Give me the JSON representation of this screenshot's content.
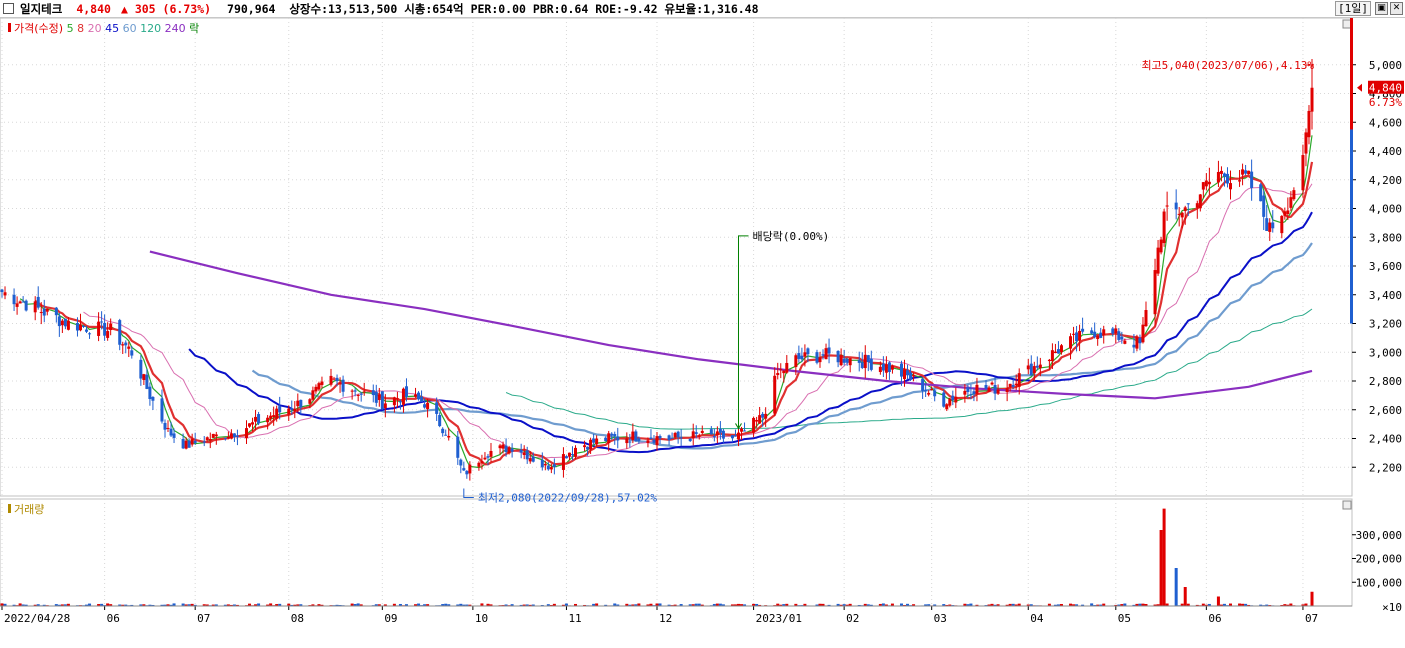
{
  "header": {
    "name": "일지테크",
    "price": "4,840",
    "change_arrow": "▲",
    "change": "305",
    "change_pct": "(6.73%)",
    "volume": "790,964",
    "listed_shares": "상장수:13,513,500",
    "market_cap": "시총:654억",
    "per": "PER:0.00",
    "pbr": "PBR:0.64",
    "roe": "ROE:-9.42",
    "reserve": "유보율:1,316.48",
    "period_label": "[1일]",
    "restore_icon": "restore-icon",
    "close_icon": "close-icon"
  },
  "legend": {
    "price_label": "가격(수정)",
    "ma_periods": [
      "5",
      "8",
      "20",
      "45",
      "60",
      "120",
      "240"
    ],
    "ma_colors": [
      "#2aa82a",
      "#e03030",
      "#d96fb0",
      "#0a10c8",
      "#6f9ccf",
      "#2aaa8a",
      "#8a2fc0"
    ],
    "ex_label": "락",
    "volume_label": "거래량"
  },
  "colors": {
    "up": "#e00000",
    "down": "#1f5fd0",
    "ma5": "#2aa82a",
    "ma8": "#e03030",
    "ma20": "#d96fb0",
    "ma45": "#0a10c8",
    "ma60": "#6f9ccf",
    "ma120": "#2aaa8a",
    "ma240": "#8a2fc0",
    "dividend": "#008000"
  },
  "annotations": {
    "high": "최고5,040(2023/07/06),4.13%",
    "low": "최저2,080(2022/09/28),57.02%",
    "dividend": "배당락(0.00%)",
    "current_price": "4,840",
    "current_pct": "6.73%"
  },
  "chart_data": {
    "type": "candlestick",
    "x_ticks": [
      "2022/04/28",
      "06",
      "07",
      "08",
      "09",
      "10",
      "11",
      "12",
      "2023/01",
      "02",
      "03",
      "04",
      "05",
      "06",
      "07"
    ],
    "y_ticks": [
      "2,200",
      "2,400",
      "2,600",
      "2,800",
      "3,000",
      "3,200",
      "3,400",
      "3,600",
      "3,800",
      "4,000",
      "4,200",
      "4,400",
      "4,600",
      "4,800",
      "5,000"
    ],
    "ylim": [
      2000,
      5200
    ],
    "close_path": [
      [
        "2022-04-28",
        3420
      ],
      [
        "2022-05-10",
        3300
      ],
      [
        "2022-05-20",
        3200
      ],
      [
        "2022-06-03",
        3150
      ],
      [
        "2022-06-10",
        3000
      ],
      [
        "2022-06-16",
        2700
      ],
      [
        "2022-06-22",
        2450
      ],
      [
        "2022-06-28",
        2350
      ],
      [
        "2022-07-05",
        2400
      ],
      [
        "2022-07-15",
        2450
      ],
      [
        "2022-07-25",
        2550
      ],
      [
        "2022-08-05",
        2650
      ],
      [
        "2022-08-15",
        2800
      ],
      [
        "2022-08-22",
        2750
      ],
      [
        "2022-09-01",
        2650
      ],
      [
        "2022-09-08",
        2700
      ],
      [
        "2022-09-15",
        2650
      ],
      [
        "2022-09-22",
        2450
      ],
      [
        "2022-09-28",
        2150
      ],
      [
        "2022-10-05",
        2300
      ],
      [
        "2022-10-15",
        2350
      ],
      [
        "2022-10-25",
        2200
      ],
      [
        "2022-11-05",
        2350
      ],
      [
        "2022-11-15",
        2400
      ],
      [
        "2022-11-25",
        2420
      ],
      [
        "2022-12-05",
        2400
      ],
      [
        "2022-12-15",
        2420
      ],
      [
        "2022-12-27",
        2400
      ],
      [
        "2023-01-05",
        2550
      ],
      [
        "2023-01-10",
        2850
      ],
      [
        "2023-01-16",
        2950
      ],
      [
        "2023-01-25",
        2980
      ],
      [
        "2023-02-05",
        2950
      ],
      [
        "2023-02-15",
        2900
      ],
      [
        "2023-02-25",
        2800
      ],
      [
        "2023-03-05",
        2650
      ],
      [
        "2023-03-15",
        2750
      ],
      [
        "2023-03-25",
        2750
      ],
      [
        "2023-04-05",
        2900
      ],
      [
        "2023-04-15",
        3050
      ],
      [
        "2023-04-25",
        3150
      ],
      [
        "2023-05-05",
        3100
      ],
      [
        "2023-05-10",
        3050
      ],
      [
        "2023-05-15",
        3600
      ],
      [
        "2023-05-18",
        3950
      ],
      [
        "2023-05-25",
        4000
      ],
      [
        "2023-06-05",
        4250
      ],
      [
        "2023-06-15",
        4200
      ],
      [
        "2023-06-22",
        3850
      ],
      [
        "2023-06-28",
        4050
      ],
      [
        "2023-07-03",
        4300
      ],
      [
        "2023-07-06",
        4840
      ]
    ],
    "ma240_path": [
      [
        "2022-06-16",
        3700
      ],
      [
        "2022-07-15",
        3550
      ],
      [
        "2022-08-15",
        3400
      ],
      [
        "2022-09-15",
        3300
      ],
      [
        "2022-10-15",
        3180
      ],
      [
        "2022-11-15",
        3050
      ],
      [
        "2022-12-15",
        2950
      ],
      [
        "2023-01-15",
        2870
      ],
      [
        "2023-02-15",
        2800
      ],
      [
        "2023-03-15",
        2750
      ],
      [
        "2023-04-15",
        2710
      ],
      [
        "2023-05-15",
        2680
      ],
      [
        "2023-06-15",
        2760
      ],
      [
        "2023-07-06",
        2870
      ]
    ],
    "volume_axis": {
      "ticks": [
        "100,000",
        "200,000",
        "300,000"
      ],
      "unit": "×10",
      "ylim": [
        0,
        400000
      ]
    },
    "volume_spikes": [
      [
        "2023-05-17",
        320000
      ],
      [
        "2023-05-18",
        410000
      ],
      [
        "2023-05-22",
        160000
      ],
      [
        "2023-05-25",
        80000
      ],
      [
        "2023-06-05",
        40000
      ],
      [
        "2023-07-06",
        60000
      ]
    ],
    "dividend_date": "2022-12-28",
    "high_point": [
      "2023-07-06",
      5040
    ],
    "low_point": [
      "2022-09-28",
      2080
    ],
    "current": 4840
  }
}
